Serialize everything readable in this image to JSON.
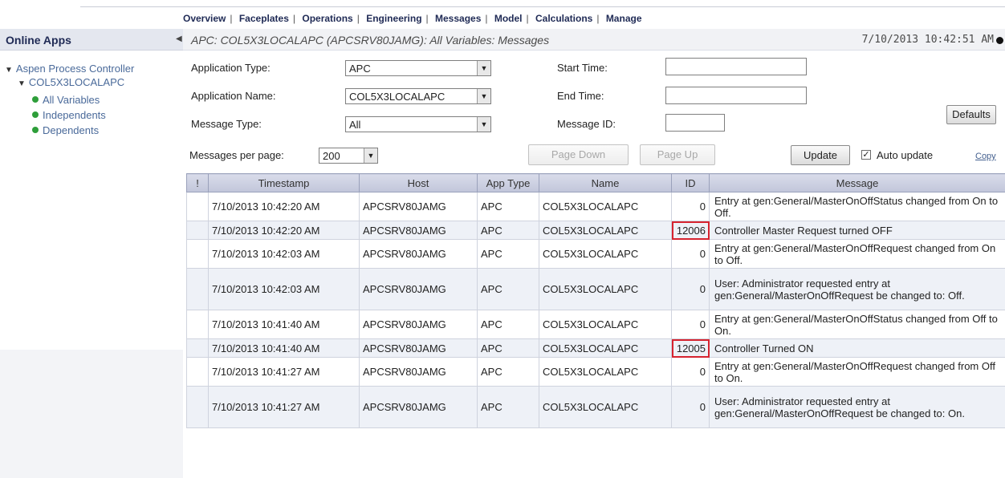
{
  "nav": {
    "items": [
      "Overview",
      "Faceplates",
      "Operations",
      "Engineering",
      "Messages",
      "Model",
      "Calculations",
      "Manage"
    ],
    "separator": "|"
  },
  "sidebar": {
    "title": "Online Apps",
    "tree": {
      "root": "Aspen Process Controller",
      "app": "COL5X3LOCALAPC",
      "children": [
        "All Variables",
        "Independents",
        "Dependents"
      ]
    }
  },
  "header": {
    "title": "APC: COL5X3LOCALAPC (APCSRV80JAMG): All Variables: Messages",
    "timestamp": "7/10/2013 10:42:51 AM"
  },
  "filters": {
    "application_type_label": "Application Type:",
    "application_type_value": "APC",
    "application_name_label": "Application Name:",
    "application_name_value": "COL5X3LOCALAPC",
    "message_type_label": "Message Type:",
    "message_type_value": "All",
    "start_time_label": "Start Time:",
    "end_time_label": "End Time:",
    "message_id_label": "Message ID:",
    "start_time_value": "",
    "end_time_value": "",
    "message_id_value": "",
    "defaults_label": "Defaults"
  },
  "paging": {
    "per_page_label": "Messages per page:",
    "per_page_value": "200",
    "page_down_label": "Page Down",
    "page_up_label": "Page Up",
    "update_label": "Update",
    "auto_update_label": "Auto update",
    "auto_update_checked": true,
    "copy_label": "Copy"
  },
  "table": {
    "columns": [
      "!",
      "Timestamp",
      "Host",
      "App Type",
      "Name",
      "ID",
      "Message"
    ],
    "rows": [
      {
        "timestamp": "7/10/2013 10:42:20 AM",
        "host": "APCSRV80JAMG",
        "app_type": "APC",
        "name": "COL5X3LOCALAPC",
        "id": "0",
        "message": "Entry at gen:General/MasterOnOffStatus changed from On to Off.",
        "highlight": false
      },
      {
        "timestamp": "7/10/2013 10:42:20 AM",
        "host": "APCSRV80JAMG",
        "app_type": "APC",
        "name": "COL5X3LOCALAPC",
        "id": "12006",
        "message": "Controller Master Request turned OFF",
        "highlight": true
      },
      {
        "timestamp": "7/10/2013 10:42:03 AM",
        "host": "APCSRV80JAMG",
        "app_type": "APC",
        "name": "COL5X3LOCALAPC",
        "id": "0",
        "message": "Entry at gen:General/MasterOnOffRequest changed from On to Off.",
        "highlight": false
      },
      {
        "timestamp": "7/10/2013 10:42:03 AM",
        "host": "APCSRV80JAMG",
        "app_type": "APC",
        "name": "COL5X3LOCALAPC",
        "id": "0",
        "message": "User: Administrator requested entry at gen:General/MasterOnOffRequest be changed to: Off.",
        "highlight": false
      },
      {
        "timestamp": "7/10/2013 10:41:40 AM",
        "host": "APCSRV80JAMG",
        "app_type": "APC",
        "name": "COL5X3LOCALAPC",
        "id": "0",
        "message": "Entry at gen:General/MasterOnOffStatus changed from Off to On.",
        "highlight": false
      },
      {
        "timestamp": "7/10/2013 10:41:40 AM",
        "host": "APCSRV80JAMG",
        "app_type": "APC",
        "name": "COL5X3LOCALAPC",
        "id": "12005",
        "message": "Controller Turned ON",
        "highlight": true
      },
      {
        "timestamp": "7/10/2013 10:41:27 AM",
        "host": "APCSRV80JAMG",
        "app_type": "APC",
        "name": "COL5X3LOCALAPC",
        "id": "0",
        "message": "Entry at gen:General/MasterOnOffRequest changed from Off to On.",
        "highlight": false
      },
      {
        "timestamp": "7/10/2013 10:41:27 AM",
        "host": "APCSRV80JAMG",
        "app_type": "APC",
        "name": "COL5X3LOCALAPC",
        "id": "0",
        "message": "User: Administrator requested entry at gen:General/MasterOnOffRequest be changed to: On.",
        "highlight": false
      }
    ]
  },
  "icons": {
    "tree_expand": "triangle-down-icon",
    "tree_leaf": "green-dot-icon",
    "dropdown": "chevron-down-icon",
    "collapse_panel": "collapse-left-icon",
    "status": "status-dot-icon"
  },
  "colors": {
    "highlight_border": "#d6232f",
    "leaf_dot": "#2e9e3a",
    "nav_text": "#1f2a55",
    "row_alt": "#eef1f7"
  }
}
